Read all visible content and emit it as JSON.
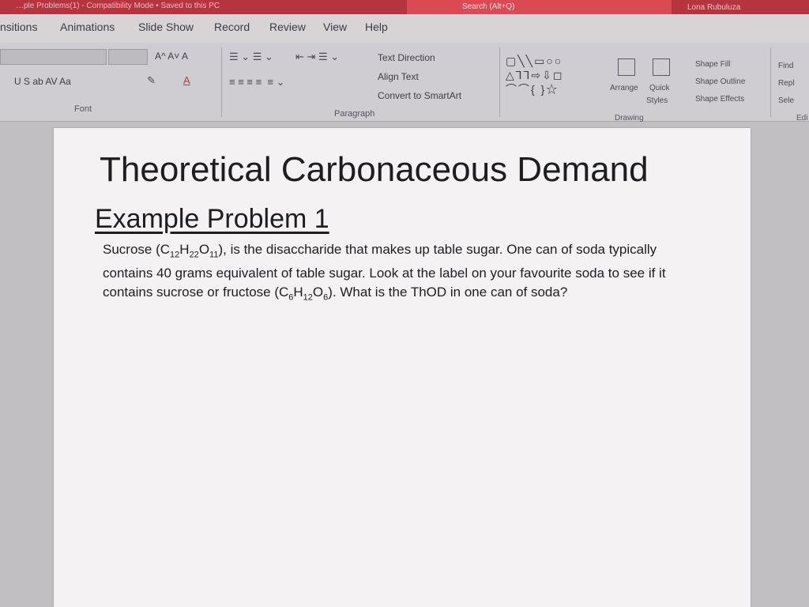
{
  "titlebar": {
    "doc_title": "…ple Problems(1) - Compatibility Mode • Saved to this PC",
    "search": "Search (Alt+Q)",
    "user": "Lona Rubuluza"
  },
  "tabs": [
    "nsitions",
    "Animations",
    "Slide Show",
    "Record",
    "Review",
    "View",
    "Help"
  ],
  "ribbon": {
    "font_group": "Font",
    "paragraph_group": "Paragraph",
    "drawing_group": "Drawing",
    "editing_group": "Edi",
    "text_direction": "Text Direction",
    "align_text": "Align Text",
    "convert_smartart": "Convert to SmartArt",
    "arrange": "Arrange",
    "quick_styles_1": "Quick",
    "quick_styles_2": "Styles",
    "shape_fill": "Shape Fill",
    "shape_outline": "Shape Outline",
    "shape_effects": "Shape Effects",
    "find": "Find",
    "replace": "Repl",
    "select": "Sele",
    "font_format_row": "U  S  ab  AV  Aa",
    "font_size_row": "A^  A˅  A"
  },
  "slide": {
    "title": "Theoretical Carbonaceous Demand",
    "subtitle": "Example Problem 1",
    "body_part1": "Sucrose (C",
    "body_sub1": "12",
    "body_part2": "H",
    "body_sub2": "22",
    "body_part3": "O",
    "body_sub3": "11",
    "body_part4": "), is the disaccharide that makes up table sugar. One can of soda typically contains 40 grams equivalent of table sugar. Look at the label on your favourite soda to see if it contains sucrose or fructose (C",
    "body_sub4": "6",
    "body_part5": "H",
    "body_sub5": "12",
    "body_part6": "O",
    "body_sub6": "6",
    "body_part7": "). What is the ThOD in one can of soda?"
  }
}
